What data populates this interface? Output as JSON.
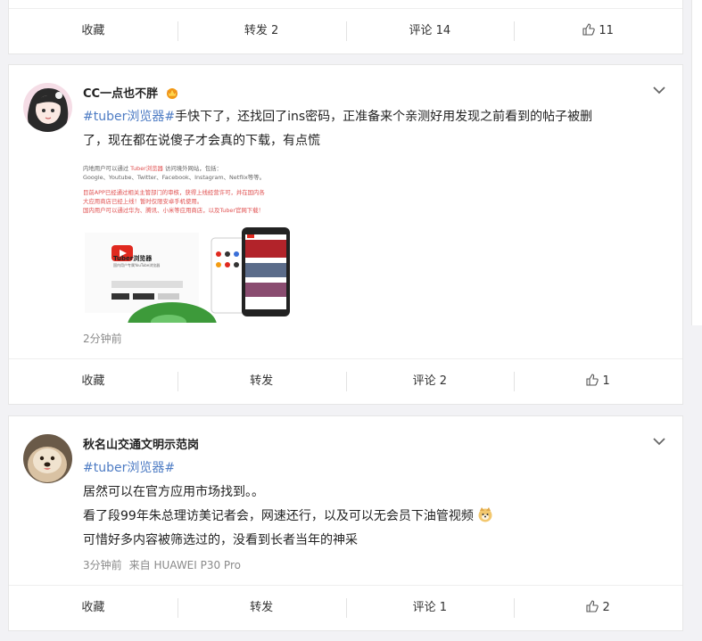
{
  "post0": {
    "actions": {
      "collect": "收藏",
      "repost": "转发 2",
      "comment": "评论 14",
      "like": "11"
    }
  },
  "post1": {
    "user": "CC一点也不胖",
    "tag": "#tuber浏览器#",
    "text_after_tag": "手快下了，还找回了ins密码，正准备来个亲测好用发现之前看到的帖子被删",
    "text_line2": "了，现在都在说傻子才会真的下载，有点慌",
    "time": "2分钟前",
    "promo": {
      "line1a": "内地用户可以通过 ",
      "line1b": "Tuber浏览器",
      "line1c": " 访问境外网站，包括：",
      "line2": "Google、Youtube、Twitter、Facebook、Instagram、Netflix等等。",
      "line3": "目前APP已经通过相关主管部门的审核，获得上线经营许可，并在国内各",
      "line4": "大应用商店已经上线！暂时仅限安卓手机使用。",
      "line5": "国内用户可以通过华为、腾讯、小米等应用商店，以及Tuber官网下载！",
      "brand": "Tuber浏览器",
      "slogan": "国内用户专属YouTube浏览器"
    },
    "actions": {
      "collect": "收藏",
      "repost": "转发",
      "comment": "评论 2",
      "like": "1"
    }
  },
  "post2": {
    "user": "秋名山交通文明示范岗",
    "tag": "#tuber浏览器#",
    "line1": "居然可以在官方应用市场找到。。",
    "line2": "看了段99年朱总理访美记者会，网速还行，以及可以无会员下油管视频",
    "line3": "可惜好多内容被筛选过的，没看到长者当年的神采",
    "time": "3分钟前",
    "source": "来自 HUAWEI P30 Pro",
    "actions": {
      "collect": "收藏",
      "repost": "转发",
      "comment": "评论 1",
      "like": "2"
    }
  },
  "colors": {
    "tag": "#4e7cc4",
    "background": "#f2f2f5",
    "promo_red": "#e05050"
  }
}
